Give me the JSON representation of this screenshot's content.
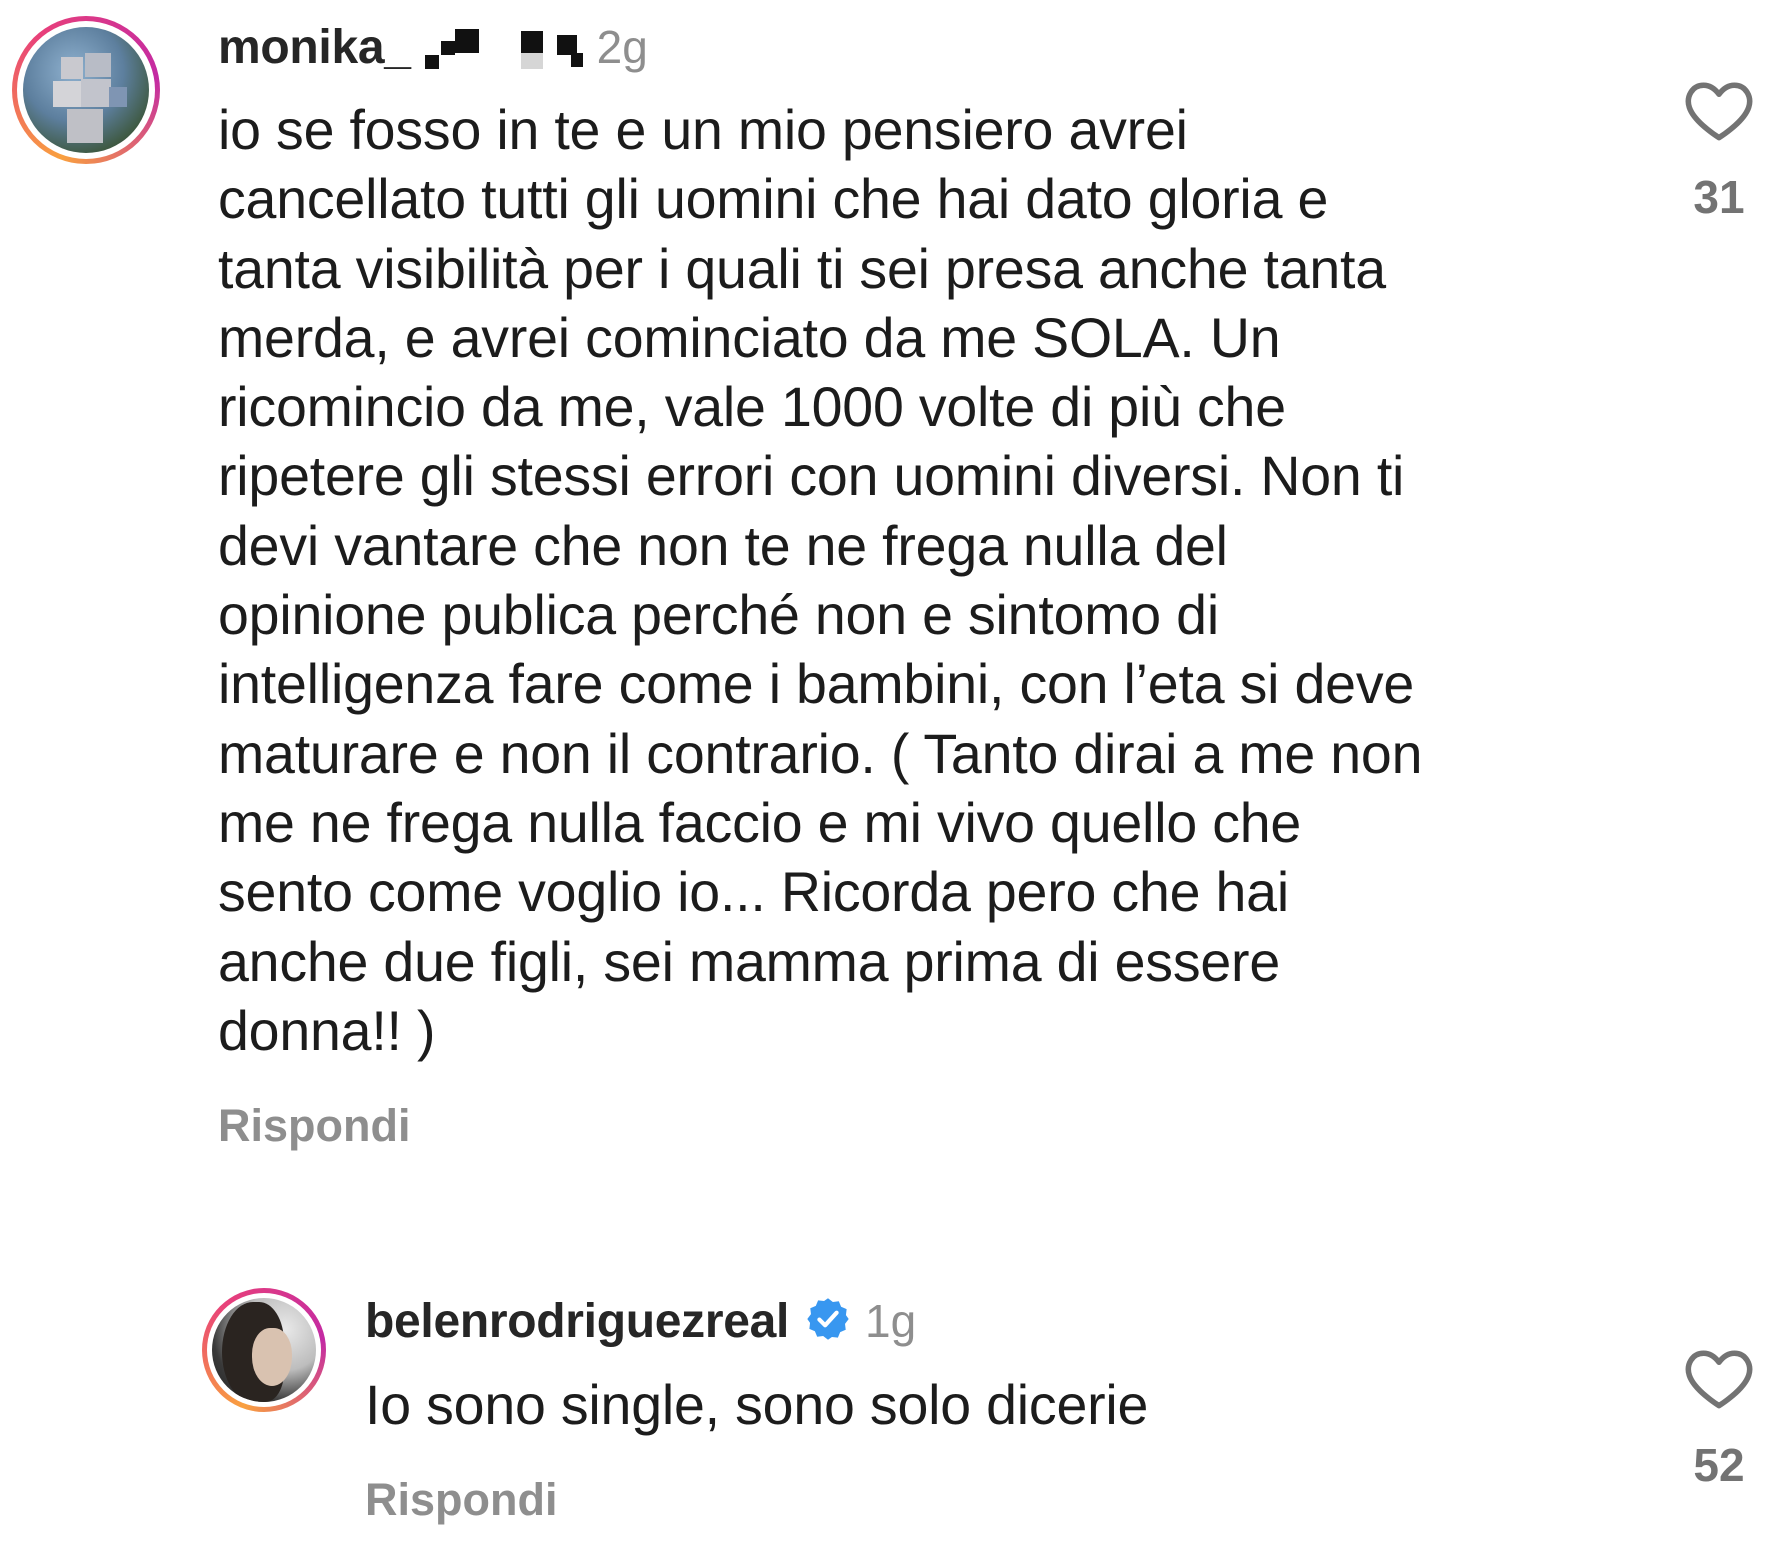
{
  "comments": [
    {
      "username": "monika_",
      "time": "2g",
      "text": "io se fosso in te e un mio pensiero avrei\ncancellato tutti gli uomini che hai dato gloria e\ntanta visibilità per i quali ti sei presa anche tanta\nmerda, e avrei cominciato da me SOLA. Un\nricomincio da me, vale 1000 volte di più che\nripetere gli stessi errori con uomini diversi. Non ti\ndevi vantare che non te ne frega nulla del\nopinione publica perché non e sintomo di\nintelligenza fare come i bambini, con l’eta si deve\nmaturare e non il contrario. ( Tanto dirai a me non\nme ne frega nulla faccio e mi vivo quello che\nsento come voglio io... Ricorda pero che hai\nanche due figli, sei mamma prima di essere\ndonna!! )",
      "reply_label": "Rispondi",
      "likes": "31",
      "username_censored": true
    },
    {
      "username": "belenrodriguezreal",
      "verified": true,
      "time": "1g",
      "text": "Io sono single, sono solo dicerie",
      "reply_label": "Rispondi",
      "likes": "52"
    }
  ],
  "colors": {
    "text": "#1c1c1c",
    "muted": "#8e8e8e",
    "verified": "#3897f0",
    "story_ring": [
      "#f9a03f",
      "#e8407a",
      "#c32aa3"
    ]
  },
  "icons": {
    "like": "heart-outline-icon",
    "verified": "verified-badge-icon"
  }
}
